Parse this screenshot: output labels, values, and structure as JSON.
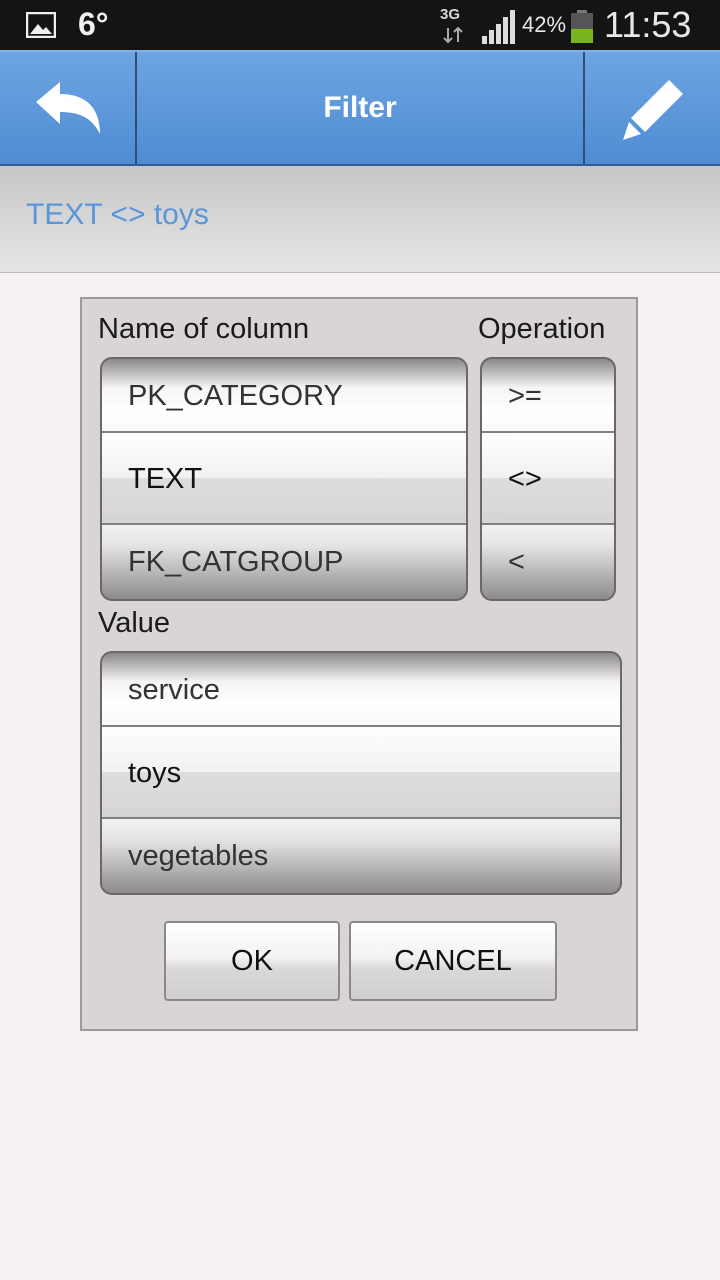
{
  "status_bar": {
    "temperature": "6°",
    "network": "3G",
    "battery": "42%",
    "time": "11:53",
    "icons": [
      "gallery-icon",
      "data-arrows-icon",
      "signal-icon",
      "battery-icon"
    ]
  },
  "action_bar": {
    "title": "Filter",
    "back_icon": "back-arrow-icon",
    "edit_icon": "pencil-icon",
    "color": "#5b95d8"
  },
  "filter_summary": "TEXT <> toys",
  "dialog": {
    "column_label": "Name of column",
    "operation_label": "Operation",
    "value_label": "Value",
    "columns": [
      "PK_CATEGORY",
      "TEXT",
      "FK_CATGROUP"
    ],
    "selected_column": "TEXT",
    "operations": [
      ">=",
      "<>",
      "<"
    ],
    "selected_operation": "<>",
    "values": [
      "service",
      "toys",
      "vegetables"
    ],
    "selected_value": "toys",
    "ok_label": "OK",
    "cancel_label": "CANCEL"
  }
}
